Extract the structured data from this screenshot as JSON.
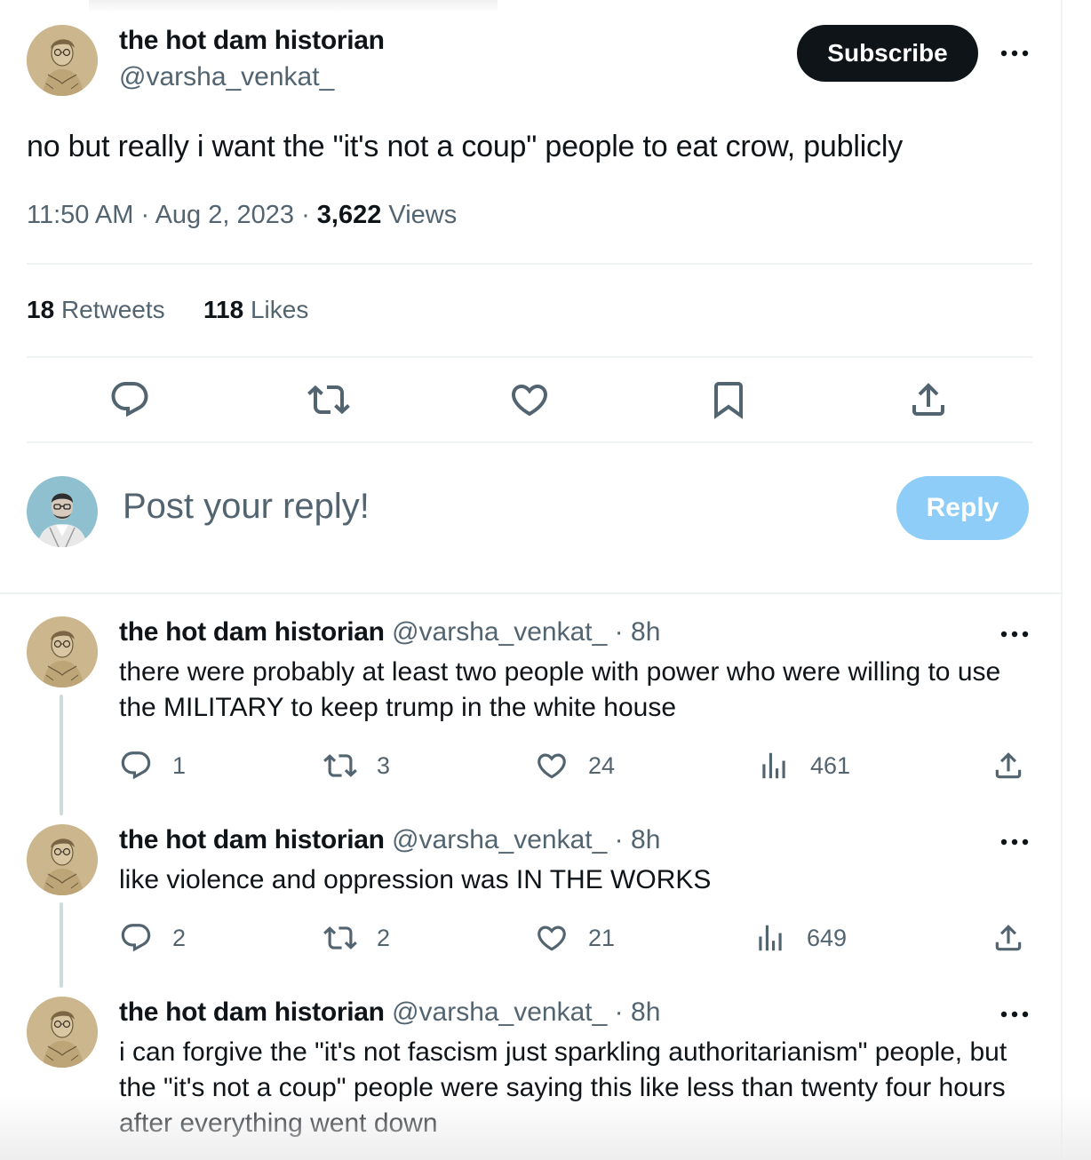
{
  "tweet": {
    "author": {
      "name": "the hot dam historian",
      "handle": "@varsha_venkat_"
    },
    "subscribe_label": "Subscribe",
    "text": "no but really i want the \"it's not a coup\" people to eat crow, publicly",
    "time": "11:50 AM",
    "date": "Aug 2, 2023",
    "views_count": "3,622",
    "views_label": "Views",
    "retweets_count": "18",
    "retweets_label": "Retweets",
    "likes_count": "118",
    "likes_label": "Likes",
    "actions": [
      "reply-icon",
      "retweet-icon",
      "like-icon",
      "bookmark-icon",
      "share-icon"
    ]
  },
  "composer": {
    "placeholder": "Post your reply!",
    "reply_label": "Reply"
  },
  "colors": {
    "text": "#0f1419",
    "secondary": "#536471",
    "subscribe_bg": "#0f1419",
    "reply_button_disabled": "#8ecdf8",
    "divider": "#eff3f4",
    "thread_line": "#cfd9de"
  },
  "replies": [
    {
      "name": "the hot dam historian",
      "handle": "@varsha_venkat_",
      "time": "8h",
      "text": "there were probably at least two people with power who were willing to use the MILITARY to keep trump in the white house",
      "replies": "1",
      "retweets": "3",
      "likes": "24",
      "views": "461"
    },
    {
      "name": "the hot dam historian",
      "handle": "@varsha_venkat_",
      "time": "8h",
      "text": "like violence and oppression was IN THE WORKS",
      "replies": "2",
      "retweets": "2",
      "likes": "21",
      "views": "649"
    },
    {
      "name": "the hot dam historian",
      "handle": "@varsha_venkat_",
      "time": "8h",
      "text": "i can forgive the \"it's not fascism just sparkling authoritarianism\" people, but the \"it's not a coup\" people were saying this like less than twenty four hours after everything went down"
    }
  ]
}
